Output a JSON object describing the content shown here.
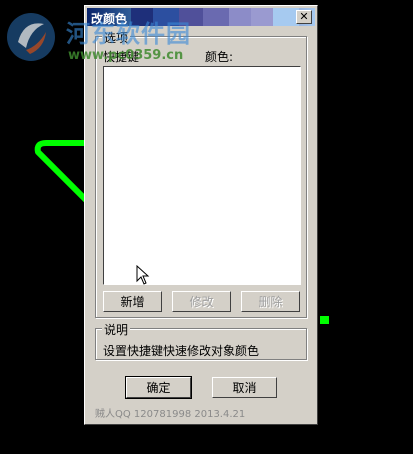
{
  "dialog": {
    "title": "改颜色",
    "close_glyph": "✕"
  },
  "options_group": {
    "label": "选项",
    "col_shortcut": "快捷键",
    "col_color": "颜色:"
  },
  "buttons": {
    "add": "新增",
    "modify": "修改",
    "delete": "删除",
    "ok": "确定",
    "cancel": "取消"
  },
  "description_group": {
    "label": "说明",
    "text": "设置快捷键快速修改对象颜色"
  },
  "footer": {
    "text": "贼人QQ 120781998 2013.4.21"
  },
  "watermark": {
    "title": "河东软件园",
    "url": "www.pc0359.cn"
  },
  "colors": {
    "background": "#000000",
    "dialog_face": "#d4d0c8",
    "cad_line": "#00ff00"
  },
  "icons": [
    "close-icon",
    "mouse-cursor-icon",
    "watermark-logo"
  ]
}
